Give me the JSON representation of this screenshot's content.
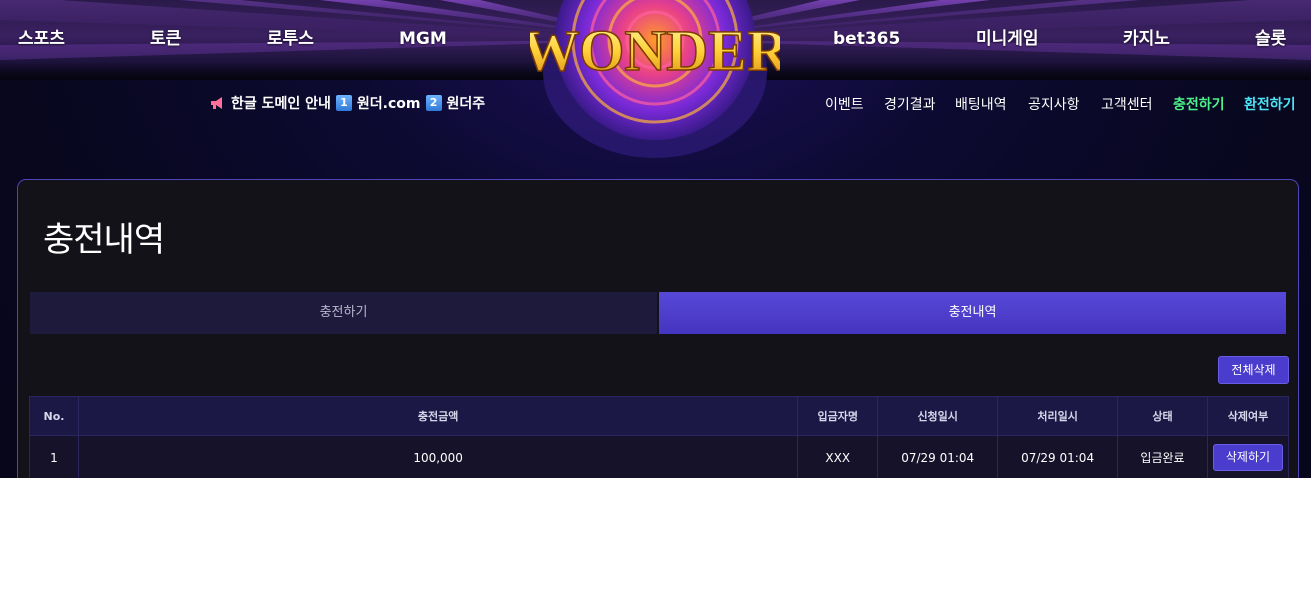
{
  "nav": {
    "left": [
      "스포츠",
      "토큰",
      "로투스",
      "MGM"
    ],
    "right": [
      "bet365",
      "미니게임",
      "카지노",
      "슬롯"
    ]
  },
  "logo": {
    "text": "WONDER"
  },
  "notice": {
    "label": "한글 도메인 안내",
    "domains": [
      {
        "num": "1",
        "name": "원더.com"
      },
      {
        "num": "2",
        "name": "원더주"
      }
    ]
  },
  "submenu": [
    {
      "label": "이벤트",
      "color": "#ffffff"
    },
    {
      "label": "경기결과",
      "color": "#ffffff"
    },
    {
      "label": "배팅내역",
      "color": "#ffffff"
    },
    {
      "label": "공지사항",
      "color": "#ffffff"
    },
    {
      "label": "고객센터",
      "color": "#ffffff"
    },
    {
      "label": "충전하기",
      "color": "#4cf08a"
    },
    {
      "label": "환전하기",
      "color": "#4ee4f5"
    }
  ],
  "page": {
    "title": "충전내역",
    "tabs": [
      {
        "label": "충전하기",
        "active": false
      },
      {
        "label": "충전내역",
        "active": true
      }
    ],
    "delete_all_label": "전체삭제",
    "table": {
      "headers": [
        "No.",
        "충전금액",
        "입금자명",
        "신청일시",
        "처리일시",
        "상태",
        "삭제여부"
      ],
      "rows": [
        {
          "no": "1",
          "amount": "100,000",
          "depositor": "XXX",
          "requested": "07/29 01:04",
          "processed": "07/29 01:04",
          "status": "입금완료",
          "delete_label": "삭제하기"
        }
      ]
    }
  },
  "colors": {
    "accent": "#4a3ccc",
    "panel_border": "#4d45b8",
    "charge_link": "#4cf08a",
    "exchange_link": "#4ee4f5"
  }
}
